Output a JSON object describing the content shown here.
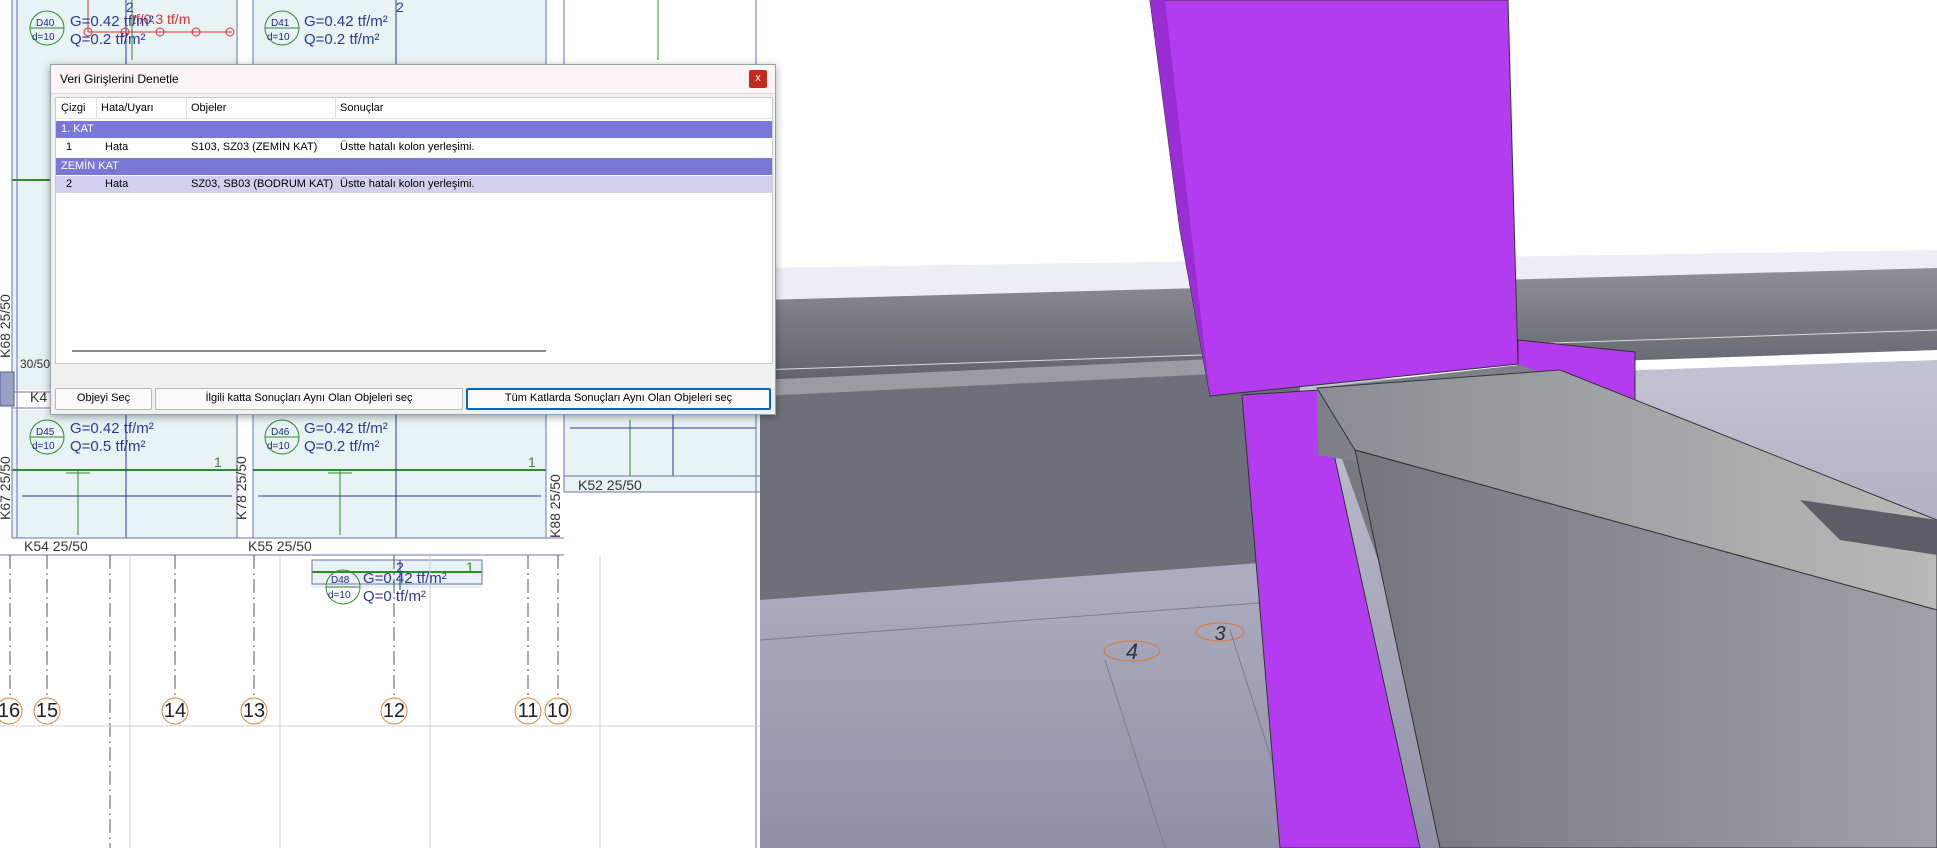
{
  "dialog": {
    "title": "Veri Girişlerini Denetle",
    "close": "x",
    "columns": [
      "Çizgi",
      "Hata/Uyarı",
      "Objeler",
      "Sonuçlar"
    ],
    "groups": [
      {
        "name": "1. KAT",
        "rows": [
          {
            "line": "1",
            "type": "Hata",
            "objects": "S103, SZ03 (ZEMİN KAT)",
            "result": "Üstte hatalı kolon yerleşimi."
          }
        ]
      },
      {
        "name": "ZEMİN KAT",
        "rows": [
          {
            "line": "2",
            "type": "Hata",
            "objects": "SZ03, SB03 (BODRUM KAT)",
            "result": "Üstte hatalı kolon yerleşimi."
          }
        ]
      }
    ],
    "buttons": {
      "select_object": "Objeyi Seç",
      "select_same_floor": "İlgili katta Sonuçları Aynı Olan Objeleri seç",
      "select_all_floors": "Tüm Katlarda Sonuçları Aynı Olan Objeleri seç"
    }
  },
  "plan": {
    "slabs": [
      {
        "id": "D40",
        "thickness": "d=10",
        "g": "G=0.42 tf/m²",
        "q": "Q=0.2 tf/m²"
      },
      {
        "id": "D41",
        "thickness": "d=10",
        "g": "G=0.42 tf/m²",
        "q": "Q=0.2 tf/m²"
      },
      {
        "id": "D45",
        "thickness": "d=10",
        "g": "G=0.42 tf/m²",
        "q": "Q=0.5 tf/m²"
      },
      {
        "id": "D46",
        "thickness": "d=10",
        "g": "G=0.42 tf/m²",
        "q": "Q=0.2 tf/m²"
      },
      {
        "id": "D48",
        "thickness": "d=10",
        "g": "G=0.42 tf/m²",
        "q": "Q=0 tf/m²"
      }
    ],
    "red_load": "tf/0.3 tf/m",
    "beams": [
      "K54 25/50",
      "K55 25/50",
      "K52 25/50",
      "K4",
      "K68 25/50",
      "K67 25/50",
      "K78 25/50",
      "K88 25/50",
      "30/50"
    ],
    "axes": [
      "16",
      "15",
      "14",
      "13",
      "12",
      "11",
      "10"
    ],
    "marks": [
      "1",
      "1",
      "2",
      "2",
      "2",
      "1"
    ]
  },
  "view3d": {
    "axis_labels": [
      "4",
      "3"
    ],
    "colors": {
      "column": "#b43cf0",
      "concrete": "#8a8d93",
      "floor": "#aeb0c2",
      "grid_edge": "#7c8088"
    }
  }
}
